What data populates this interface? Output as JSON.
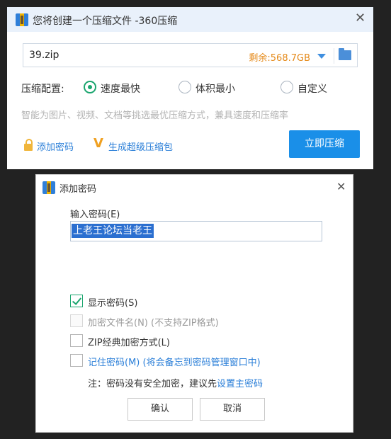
{
  "compress_window": {
    "title": "您将创建一个压缩文件 -360压缩",
    "close_glyph": "✕",
    "file_name": "39.zip",
    "free_space": "剩余:568.7GB",
    "config_label": "压缩配置:",
    "options": [
      {
        "label": "速度最快",
        "selected": true
      },
      {
        "label": "体积最小",
        "selected": false
      },
      {
        "label": "自定义",
        "selected": false
      }
    ],
    "hint": "智能为图片、视频、文档等挑选最优压缩方式，兼具速度和压缩率",
    "add_password": "添加密码",
    "super_package": "生成超级压缩包",
    "compress_now": "立即压缩"
  },
  "password_dialog": {
    "title": "添加密码",
    "close_glyph": "✕",
    "input_label": "输入密码(E)",
    "password_value": "上老王论坛当老王",
    "options": [
      {
        "label": "显示密码(S)",
        "checked": true,
        "disabled": false
      },
      {
        "label": "加密文件名(N) (不支持ZIP格式)",
        "checked": false,
        "disabled": true
      },
      {
        "label": "ZIP经典加密方式(L)",
        "checked": false,
        "disabled": false
      },
      {
        "label": "记住密码(M) (将会备忘到密码管理窗口中)",
        "checked": false,
        "disabled": false
      }
    ],
    "note_prefix": "注：密码没有安全加密，建议先",
    "note_link": "设置主密码",
    "ok": "确认",
    "cancel": "取消"
  },
  "colors": {
    "accent_blue": "#1a8fe8",
    "link_blue": "#2b7fd8",
    "green_check": "#1aa56e",
    "orange_free": "#e58a1a"
  }
}
